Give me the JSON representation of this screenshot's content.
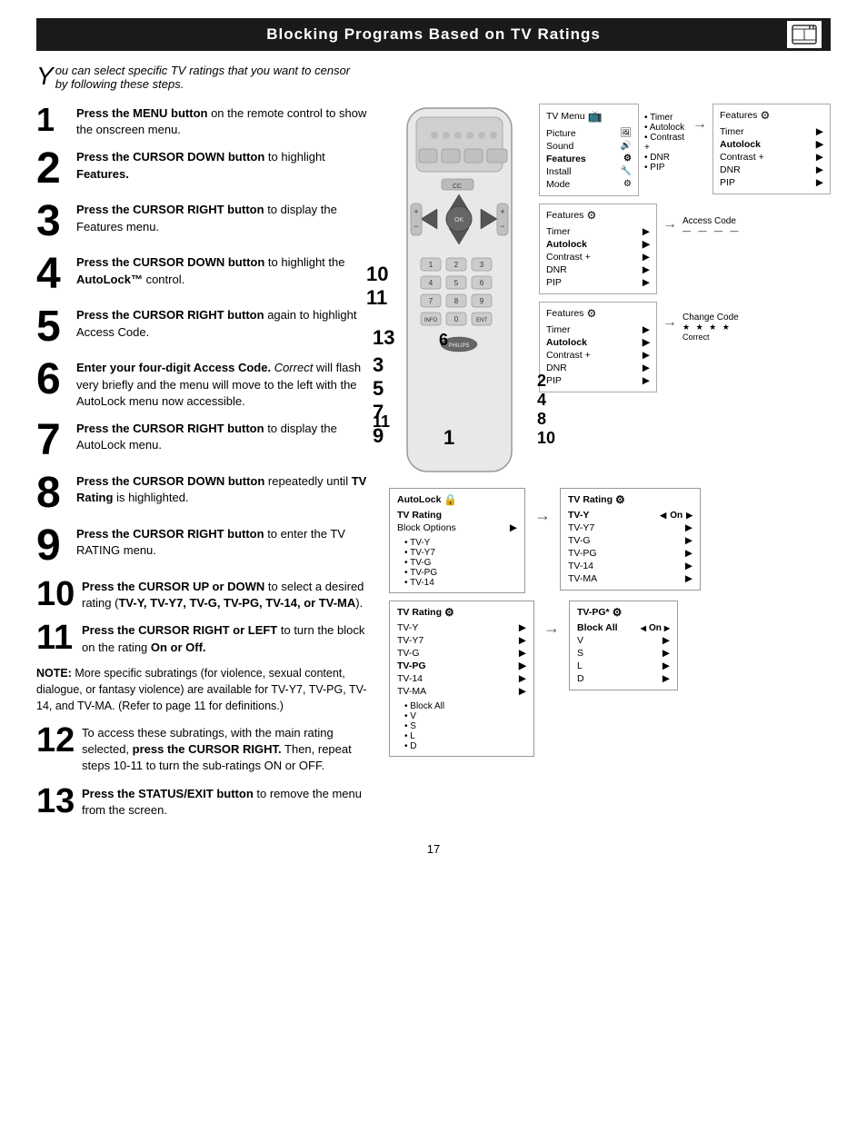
{
  "page": {
    "title": "Blocking Programs Based on TV Ratings",
    "page_number": "17"
  },
  "intro": {
    "drop_cap": "Y",
    "text": "ou can select specific TV ratings that you want to censor by following these steps."
  },
  "steps": [
    {
      "num": "1",
      "bold": "Press the MENU button",
      "rest": " on the remote control to show the onscreen menu."
    },
    {
      "num": "2",
      "bold": "Press the CURSOR DOWN button",
      "rest": " to highlight ",
      "bold2": "Features."
    },
    {
      "num": "3",
      "bold": "Press the CURSOR RIGHT button",
      "rest": " to display the Features menu."
    },
    {
      "num": "4",
      "bold": "Press the CURSOR DOWN button",
      "rest": " to highlight the ",
      "bold2": "AutoLock™",
      "rest2": " control."
    },
    {
      "num": "5",
      "bold": "Press the CURSOR RIGHT button",
      "rest": " again to highlight Access Code."
    },
    {
      "num": "6",
      "bold": "Enter your four-digit Access Code.",
      "italic": "Correct",
      "rest": " will flash very briefly and the menu will move to the left with the AutoLock menu now accessible."
    },
    {
      "num": "7",
      "bold": "Press the CURSOR RIGHT button",
      "rest": " to display the AutoLock menu."
    },
    {
      "num": "8",
      "bold": "Press the CURSOR DOWN button",
      "rest": " repeatedly until ",
      "bold2": "TV Rating",
      "rest2": " is highlighted."
    },
    {
      "num": "9",
      "bold": "Press the CURSOR RIGHT button",
      "rest": " to enter the TV RATING menu."
    },
    {
      "num": "10",
      "bold": "Press the CURSOR UP or DOWN",
      "rest": " to select a desired rating (",
      "bold2": "TV-Y, TV-Y7, TV-G, TV-PG, TV-14, or TV-MA",
      "rest2": ")."
    },
    {
      "num": "11",
      "bold": "Press the CURSOR RIGHT or LEFT",
      "rest": " to turn the block on the rating ",
      "bold2": "On or Off."
    },
    {
      "num": "12",
      "rest": "To access these subratings, with the main rating selected, ",
      "bold": "press the CURSOR RIGHT.",
      "rest2": " Then, repeat steps 10-11 to turn the sub-ratings ON or OFF."
    },
    {
      "num": "13",
      "bold": "Press the STATUS/EXIT button",
      "rest": " to remove the menu from the screen."
    }
  ],
  "note": {
    "label": "NOTE:",
    "text": " More specific subratings (for violence, sexual content, dialogue, or fantasy violence) are available for TV-Y7, TV-PG, TV-14, and TV-MA. (Refer to page 11 for definitions.)"
  },
  "diagrams": {
    "tv_menu": {
      "title": "TV Menu",
      "items": [
        "Picture",
        "Sound",
        "Features",
        "Install",
        "Mode"
      ],
      "sub_items": [
        "Timer",
        "Autolock",
        "Contrast +",
        "DNR",
        "PIP"
      ]
    },
    "features1": {
      "title": "Features",
      "items": [
        "Timer",
        "Autolock",
        "Contrast +",
        "DNR",
        "PIP"
      ],
      "arrows": true
    },
    "features2": {
      "title": "Features",
      "items": [
        "Timer",
        "Autolock",
        "Contrast +",
        "DNR",
        "PIP"
      ],
      "right_item": "Access Code"
    },
    "features3": {
      "title": "Features",
      "items": [
        "Timer",
        "Autolock",
        "Contrast +",
        "DNR",
        "PIP"
      ],
      "right_item": "Change Code",
      "right_item2": "Correct"
    },
    "autolock": {
      "title": "AutoLock",
      "items": [
        {
          "label": "TV Rating",
          "has_arrow": false
        },
        {
          "label": "Block Options",
          "has_arrow": true
        }
      ],
      "sub_items": [
        "TV-Y",
        "TV-Y7",
        "TV-G",
        "TV-PG",
        "TV-14"
      ]
    },
    "tv_rating1": {
      "title": "TV Rating",
      "items": [
        "TV-Y",
        "TV-Y7",
        "TV-G",
        "TV-PG",
        "TV-14",
        "TV-MA"
      ],
      "selected": "TV-Y",
      "value": "On"
    },
    "tv_rating2": {
      "title": "TV Rating",
      "items": [
        "TV-Y",
        "TV-Y7",
        "TV-G",
        "TV-PG",
        "TV-14",
        "TV-MA"
      ],
      "selected": "TV-PG"
    },
    "tvpg": {
      "title": "TV-PG*",
      "items": [
        "Block All",
        "V",
        "S",
        "L",
        "D"
      ],
      "selected": "Block All",
      "value": "On"
    }
  }
}
